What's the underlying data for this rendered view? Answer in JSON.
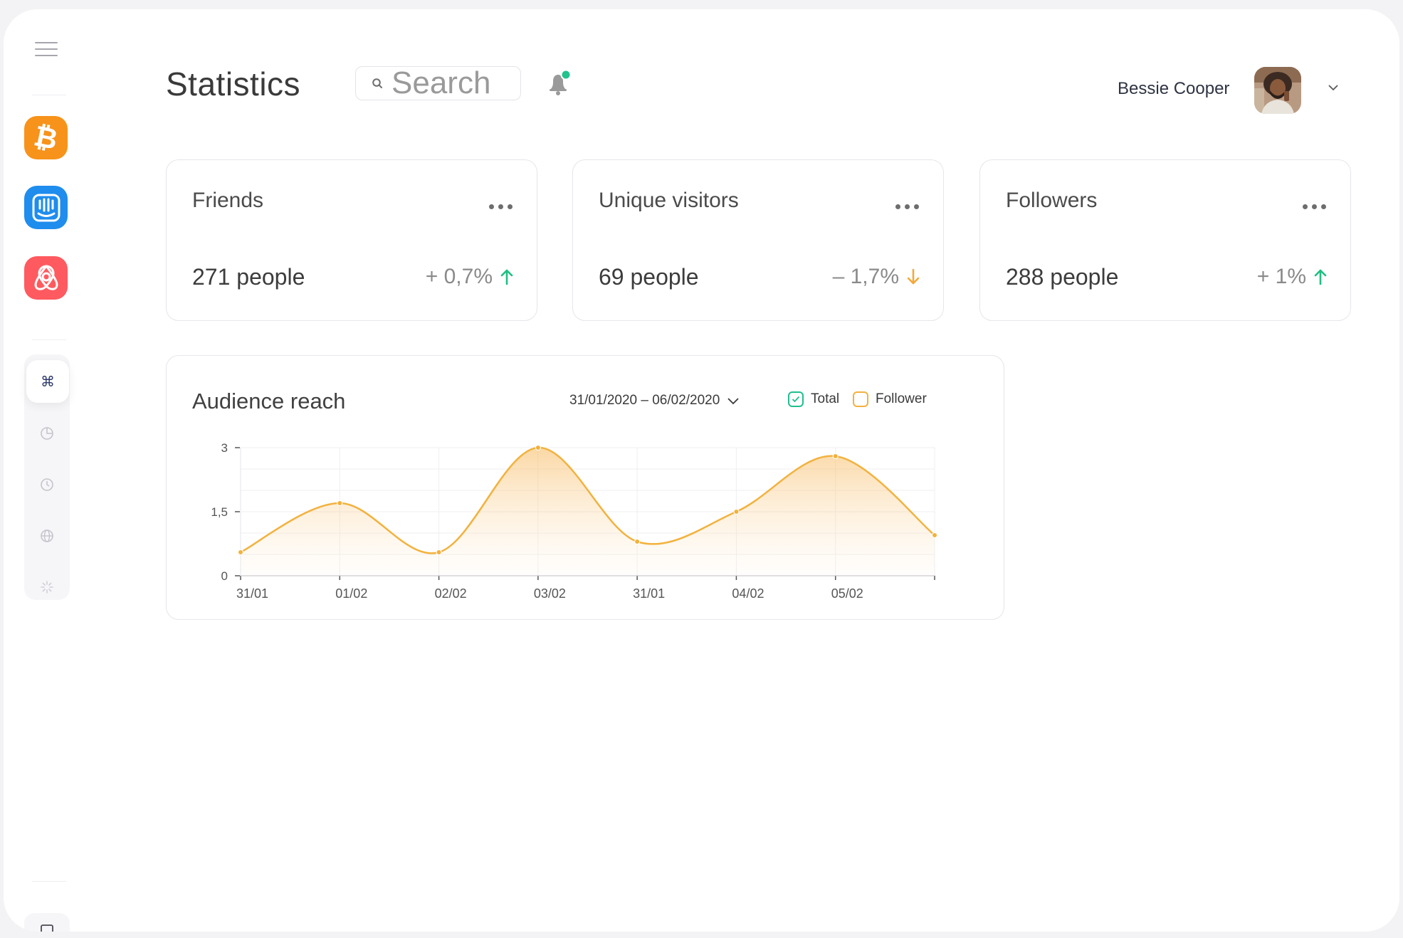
{
  "header": {
    "title": "Statistics",
    "search_placeholder": "Search",
    "notification_color": "#22c38e",
    "user_name": "Bessie Cooper"
  },
  "sidebar": {
    "apps": [
      {
        "name": "bitcoin-app-icon",
        "color": "#f7931a"
      },
      {
        "name": "intercom-app-icon",
        "color": "#1f8ded"
      },
      {
        "name": "airbnb-app-icon",
        "color": "#ff5a5f"
      }
    ],
    "nav": [
      "command-icon",
      "pie-chart-icon",
      "clock-icon",
      "globe-icon",
      "loader-icon"
    ],
    "active_nav": "command-icon"
  },
  "stats": [
    {
      "label": "Friends",
      "value": "271 people",
      "change": "+ 0,7%",
      "trend": "up"
    },
    {
      "label": "Unique visitors",
      "value": "69 people",
      "change": "– 1,7%",
      "trend": "down"
    },
    {
      "label": "Followers",
      "value": "288 people",
      "change": "+ 1%",
      "trend": "up"
    }
  ],
  "colors": {
    "up": "#1fbf83",
    "down": "#f2a93b",
    "accent": "#f2b23e",
    "total_check": "#1fbf8f"
  },
  "audience": {
    "title": "Audience reach",
    "date_range": "31/01/2020 – 06/02/2020",
    "legend": [
      {
        "label": "Total",
        "checked": true,
        "color": "#1fbf8f"
      },
      {
        "label": "Follower",
        "checked": false,
        "color": "#f2b23e"
      }
    ]
  },
  "chart_data": {
    "type": "area",
    "title": "Audience reach",
    "categories": [
      "31/01",
      "01/02",
      "02/02",
      "03/02",
      "31/01",
      "04/02",
      "05/02"
    ],
    "x": [
      0,
      1,
      2,
      3,
      4,
      5,
      6,
      7
    ],
    "series": [
      {
        "name": "Follower",
        "values": [
          0.55,
          1.7,
          0.55,
          3.0,
          0.8,
          1.5,
          2.8,
          0.95
        ]
      }
    ],
    "yticks": [
      "0",
      "1,5",
      "3"
    ],
    "ylim": [
      0,
      3
    ],
    "grid": true
  }
}
